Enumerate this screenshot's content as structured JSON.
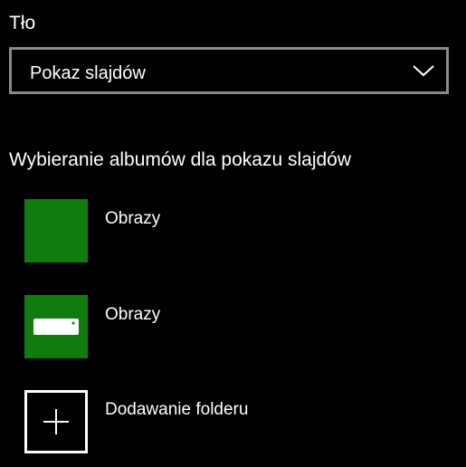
{
  "background_section": {
    "label": "Tło",
    "dropdown": {
      "selected": "Pokaz slajdów",
      "icon": "chevron-down-icon"
    }
  },
  "slideshow": {
    "heading": "Wybieranie albumów dla pokazu slajdów",
    "albums": [
      {
        "label": "Obrazy",
        "icon": "folder-thumbnail",
        "color": "#107c10"
      },
      {
        "label": "Obrazy",
        "icon": "drive-icon",
        "color": "#107c10"
      }
    ],
    "add_folder": {
      "label": "Dodawanie folderu",
      "icon": "plus-icon"
    }
  },
  "colors": {
    "background": "#000000",
    "accent": "#107c10",
    "text": "#ffffff",
    "dropdown_border": "#8a8a8a"
  }
}
